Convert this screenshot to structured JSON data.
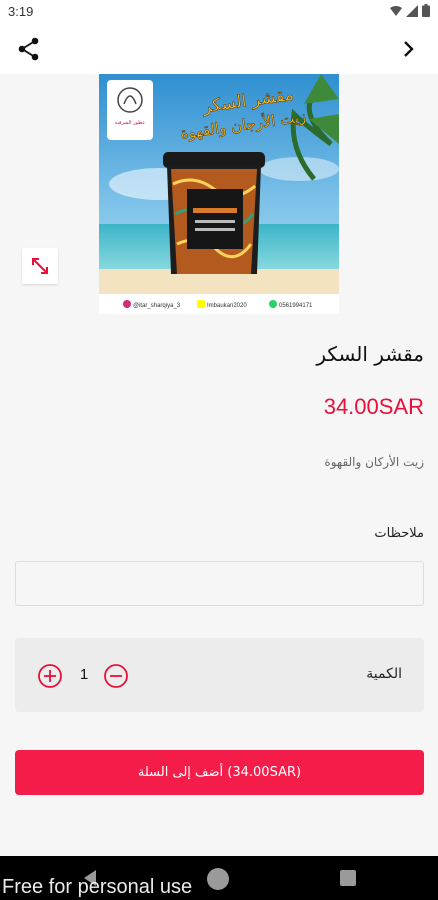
{
  "status_bar": {
    "time": "3:19"
  },
  "app_bar": {
    "share_icon": "share-icon",
    "next_icon": "chevron-right-icon"
  },
  "image": {
    "logo_text": "عطور الشرقية",
    "banner_line1": "مقشر السكر",
    "banner_line2": "زيت الأرجان والقهوة",
    "instagram": "@itar_sharqiya_3",
    "snapchat": "Imbaukan2020",
    "whatsapp": "0561994171"
  },
  "product": {
    "title": "مقشر السكر",
    "price": "34.00SAR",
    "description": "زيت الأركان والقهوة"
  },
  "notes": {
    "label": "ملاحظات",
    "value": "",
    "placeholder": ""
  },
  "quantity": {
    "label": "الكمية",
    "value": "1"
  },
  "cart_button": {
    "label": "أضف إلى السلة (34.00SAR)"
  },
  "watermark": "Free for personal use",
  "colors": {
    "accent": "#f41d4a",
    "price": "#e8103a",
    "surface": "#f6f6f6"
  }
}
